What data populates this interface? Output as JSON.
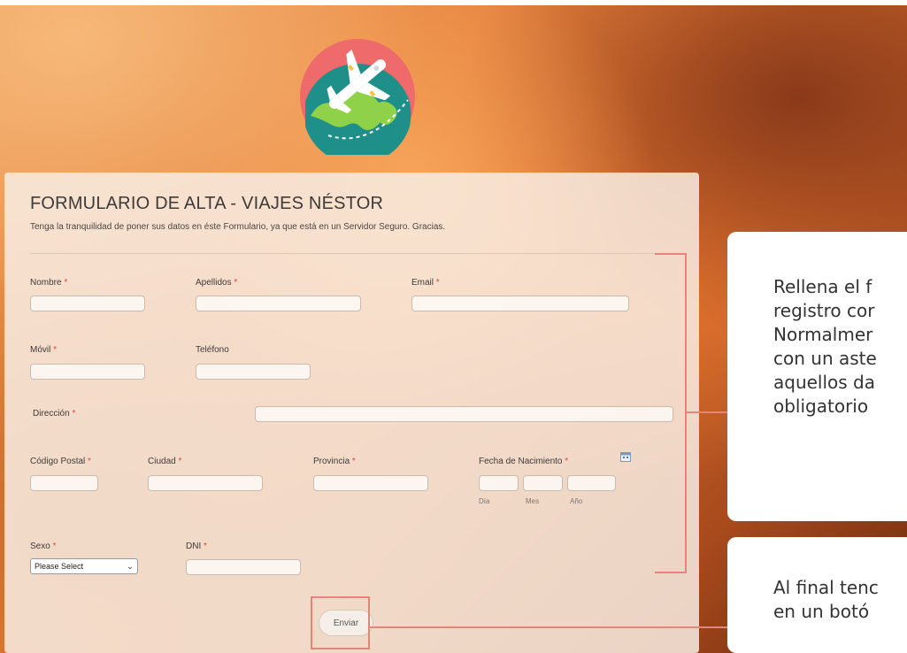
{
  "form": {
    "title": "FORMULARIO DE ALTA - VIAJES NÉSTOR",
    "subtitle": "Tenga la tranquilidad de poner sus datos en éste Formulario, ya que está en un Servidor Seguro. Gracias.",
    "required_mark": "*",
    "fields": {
      "nombre": {
        "label": "Nombre",
        "value": ""
      },
      "apellidos": {
        "label": "Apellidos",
        "value": ""
      },
      "email": {
        "label": "Email",
        "value": ""
      },
      "movil": {
        "label": "Móvil",
        "value": ""
      },
      "telefono": {
        "label": "Teléfono",
        "value": ""
      },
      "direccion": {
        "label": "Dirección",
        "value": ""
      },
      "codigo_postal": {
        "label": "Código Postal",
        "value": ""
      },
      "ciudad": {
        "label": "Ciudad",
        "value": ""
      },
      "provincia": {
        "label": "Provincia",
        "value": ""
      },
      "fecha": {
        "label": "Fecha de Nacimiento",
        "dia_label": "Día",
        "mes_label": "Mes",
        "ano_label": "Año"
      },
      "sexo": {
        "label": "Sexo",
        "selected": "Please Select"
      },
      "dni": {
        "label": "DNI",
        "value": ""
      }
    },
    "submit_label": "Enviar"
  },
  "callouts": {
    "first_lines": [
      "Rellena el f",
      "registro cor",
      "Normalmer",
      "con un aste",
      "aquellos da",
      "obligatorio"
    ],
    "second_lines": [
      "Al final tenc",
      "en un botó"
    ]
  },
  "icons": {
    "logo": "airplane-globe-logo-icon",
    "calendar": "calendar-icon",
    "chevron": "chevron-down-icon"
  },
  "colors": {
    "accent": "#e6847a",
    "required": "#e0463d",
    "logo_circle": "#ef6a6b",
    "globe": "#1f8f8a"
  }
}
